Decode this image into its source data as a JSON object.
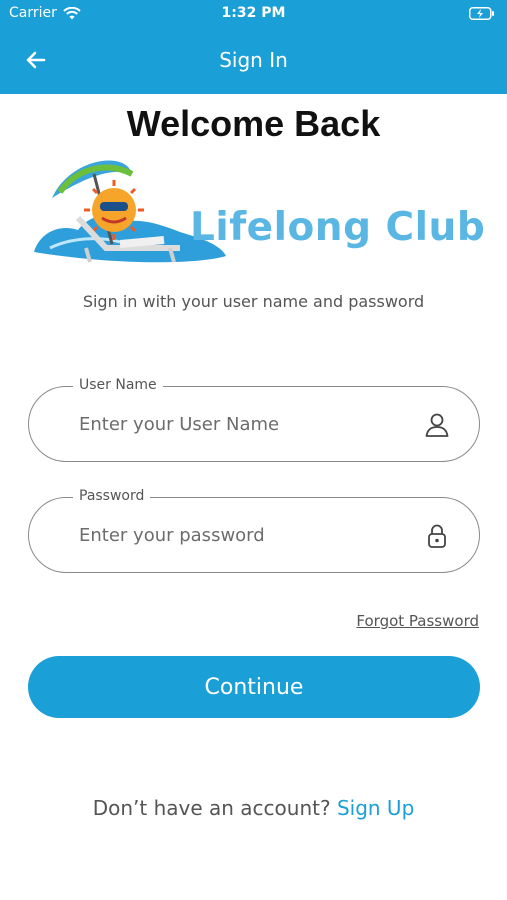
{
  "status_bar": {
    "carrier": "Carrier",
    "time": "1:32 PM",
    "icons": [
      "wifi-icon",
      "battery-charging-icon"
    ]
  },
  "nav": {
    "title": "Sign In",
    "back_icon": "arrow-left-icon"
  },
  "welcome": "Welcome Back",
  "logo": {
    "text": "Lifelong Club",
    "color": "#5ab6e2"
  },
  "subtitle": "Sign in with your user name and password",
  "username": {
    "label": "User Name",
    "placeholder": "Enter your User Name",
    "value": "",
    "icon": "user-icon"
  },
  "password": {
    "label": "Password",
    "placeholder": "Enter your password",
    "value": "",
    "icon": "lock-icon"
  },
  "forgot_password": "Forgot Password",
  "continue_label": "Continue",
  "signup": {
    "prompt": "Don’t have an account?",
    "link": "Sign Up"
  },
  "colors": {
    "accent": "#1b9fd7",
    "text": "#555555",
    "border": "#8a8a8a"
  }
}
